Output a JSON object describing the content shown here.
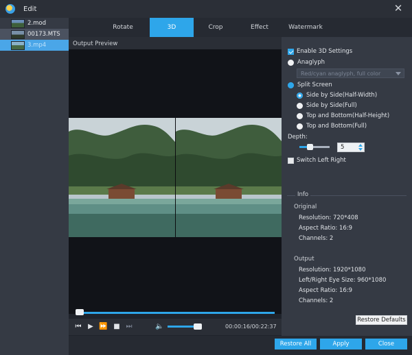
{
  "window": {
    "title": "Edit"
  },
  "files": [
    {
      "name": "2.mod",
      "state": "normal"
    },
    {
      "name": "00173.MTS",
      "state": "highlight"
    },
    {
      "name": "3.mp4",
      "state": "selected"
    }
  ],
  "tabs": [
    {
      "label": "Rotate",
      "active": false
    },
    {
      "label": "3D",
      "active": true
    },
    {
      "label": "Crop",
      "active": false
    },
    {
      "label": "Effect",
      "active": false
    },
    {
      "label": "Watermark",
      "active": false
    }
  ],
  "preview": {
    "label": "Output Preview"
  },
  "player": {
    "timecode": "00:00:16/00:22:37",
    "progress": 0.02,
    "volume": 0.85
  },
  "settings": {
    "enable_3d": {
      "label": "Enable 3D Settings",
      "checked": true
    },
    "anaglyph": {
      "label": "Anaglyph",
      "selected": false,
      "dropdown_value": "Red/cyan anaglyph, full color"
    },
    "split_screen": {
      "label": "Split Screen",
      "selected": true
    },
    "split_options": [
      {
        "label": "Side by Side(Half-Width)",
        "selected": true
      },
      {
        "label": "Side by Side(Full)",
        "selected": false
      },
      {
        "label": "Top and Bottom(Half-Height)",
        "selected": false
      },
      {
        "label": "Top and Bottom(Full)",
        "selected": false
      }
    ],
    "depth": {
      "label": "Depth:",
      "value": "5",
      "slider": 0.3
    },
    "switch_lr": {
      "label": "Switch Left Right",
      "checked": false
    }
  },
  "info": {
    "title": "Info",
    "original": {
      "heading": "Original",
      "resolution": "Resolution: 720*408",
      "aspect": "Aspect Ratio: 16:9",
      "channels": "Channels: 2"
    },
    "output": {
      "heading": "Output",
      "resolution": "Resolution: 1920*1080",
      "eye_size": "Left/Right Eye Size: 960*1080",
      "aspect": "Aspect Ratio: 16:9",
      "channels": "Channels: 2"
    }
  },
  "buttons": {
    "restore_defaults": "Restore Defaults",
    "restore_all": "Restore All",
    "apply": "Apply",
    "close": "Close"
  },
  "colors": {
    "accent": "#2ea6ea",
    "panel": "#353a44",
    "background": "#1f232b"
  }
}
